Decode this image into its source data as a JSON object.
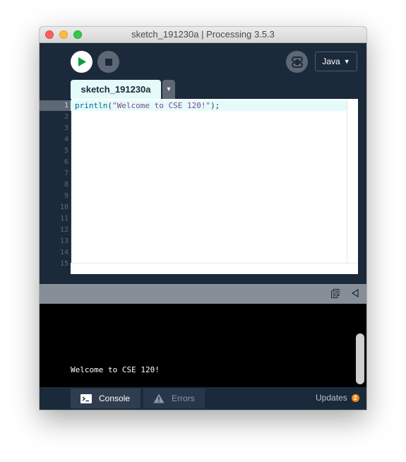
{
  "window": {
    "title": "sketch_191230a | Processing 3.5.3"
  },
  "toolbar": {
    "run_icon": "play-icon",
    "stop_icon": "stop-icon",
    "debug_icon": "debugger-icon",
    "mode_label": "Java",
    "mode_arrow": "▼"
  },
  "tabs": [
    {
      "label": "sketch_191230a",
      "active": true
    }
  ],
  "tab_menu_arrow": "▾",
  "editor": {
    "current_line": 1,
    "line_numbers": [
      "1",
      "2",
      "3",
      "4",
      "5",
      "6",
      "7",
      "8",
      "9",
      "10",
      "11",
      "12",
      "13",
      "14",
      "15"
    ],
    "code_function": "println",
    "code_open": "(",
    "code_string": "\"Welcome to CSE 120!\"",
    "code_close": ");"
  },
  "console": {
    "output": "Welcome to CSE 120!"
  },
  "status_bar": {
    "console_tab": "Console",
    "errors_tab": "Errors",
    "updates_label": "Updates",
    "updates_count": "2"
  },
  "colors": {
    "ide_background": "#1b2a3b",
    "tab_active": "#e4fbfa",
    "run_play": "#0a9e3c",
    "update_badge": "#ef8a1d"
  }
}
